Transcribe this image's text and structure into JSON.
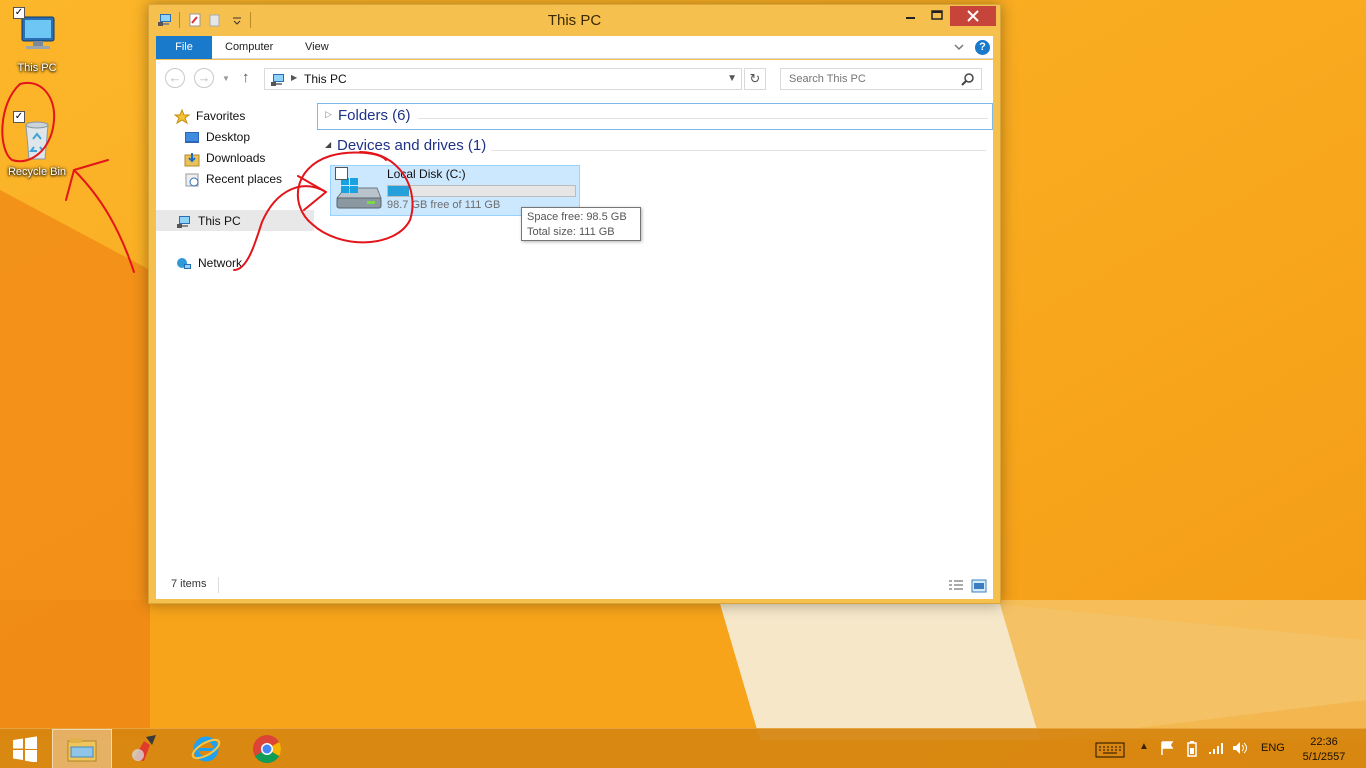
{
  "desktop": {
    "icons": [
      {
        "label": "This PC",
        "checked": true,
        "icon": "this-pc-icon"
      },
      {
        "label": "Recycle Bin",
        "checked": true,
        "icon": "recycle-bin-icon"
      }
    ]
  },
  "window": {
    "title": "This PC",
    "ribbon_tabs": [
      "File",
      "Computer",
      "View"
    ],
    "help_glyph": "?",
    "address": {
      "path": "This PC"
    },
    "search": {
      "placeholder": "Search This PC"
    },
    "nav_pane": {
      "favorites": "Favorites",
      "items": [
        "Desktop",
        "Downloads",
        "Recent places"
      ],
      "this_pc": "This PC",
      "network": "Network"
    },
    "groups": {
      "folders": "Folders (6)",
      "devices": "Devices and drives (1)"
    },
    "drive": {
      "name": "Local Disk (C:)",
      "free_text": "98.7 GB free of 111 GB",
      "used_fraction": 0.11
    },
    "tooltip": {
      "line1": "Space free: 98.5 GB",
      "line2": "Total size: 111 GB"
    },
    "status": {
      "items": "7 items"
    }
  },
  "taskbar": {
    "apps": [
      "start-icon",
      "file-explorer-icon",
      "ccleaner-icon",
      "internet-explorer-icon",
      "chrome-icon"
    ],
    "language": "ENG",
    "time": "22:36",
    "date": "5/1/2557"
  },
  "colors": {
    "window_frame": "#f6c04f",
    "close_button": "#c7443a",
    "file_tab": "#1979ca",
    "group_heading": "#1e3287",
    "selection": "#cce8ff",
    "drive_bar": "#26a0da",
    "annotation": "#e3151b"
  }
}
